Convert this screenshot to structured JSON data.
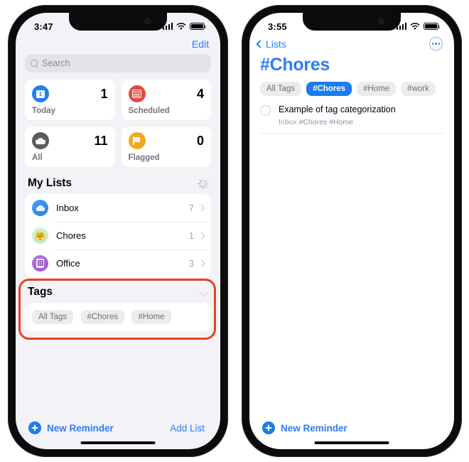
{
  "left_phone": {
    "status": {
      "time": "3:47",
      "signal_icon": "cellular-bars-icon",
      "wifi_icon": "wifi-icon",
      "battery_icon": "battery-icon"
    },
    "edit_button": "Edit",
    "search": {
      "placeholder": "Search",
      "icon": "search-icon"
    },
    "smart_lists": [
      {
        "label": "Today",
        "count": "1",
        "icon": "calendar-today-icon",
        "color": "#1e7ff0"
      },
      {
        "label": "Scheduled",
        "count": "4",
        "icon": "calendar-scheduled-icon",
        "color": "#e8453c"
      },
      {
        "label": "All",
        "count": "11",
        "icon": "tray-all-icon",
        "color": "#5a5a60"
      },
      {
        "label": "Flagged",
        "count": "0",
        "icon": "flag-icon",
        "color": "#f5a623"
      }
    ],
    "my_lists": {
      "title": "My Lists",
      "action_icon": "loading-spinner-icon",
      "items": [
        {
          "name": "Inbox",
          "count": "7",
          "icon": "inbox-icon",
          "color": "#2a7fe0"
        },
        {
          "name": "Chores",
          "count": "1",
          "icon": "chores-emoji-icon",
          "emoji": "🤗",
          "color": "#bfe9c6"
        },
        {
          "name": "Office",
          "count": "3",
          "icon": "building-icon",
          "color": "#9a55cf"
        }
      ]
    },
    "tags": {
      "title": "Tags",
      "collapse_icon": "chevron-down-icon",
      "pills": [
        "All Tags",
        "#Chores",
        "#Home"
      ],
      "highlight_color": "#e8421f"
    },
    "toolbar": {
      "new_reminder": "New Reminder",
      "add_list": "Add List",
      "plus_icon": "plus-circle-icon"
    }
  },
  "right_phone": {
    "status": {
      "time": "3:55",
      "signal_icon": "cellular-bars-icon",
      "wifi_icon": "wifi-icon",
      "battery_icon": "battery-icon"
    },
    "nav": {
      "back_label": "Lists",
      "back_icon": "chevron-left-icon",
      "more_icon": "more-circle-icon"
    },
    "title": "#Chores",
    "tag_filters": [
      {
        "label": "All Tags",
        "active": false
      },
      {
        "label": "#Chores",
        "active": true
      },
      {
        "label": "#Home",
        "active": false
      },
      {
        "label": "#work",
        "active": false
      }
    ],
    "reminders": [
      {
        "title": "Example of tag categorization",
        "list": "Inbox",
        "tags": "#Chores #Home",
        "checkbox_icon": "radio-circle-icon"
      }
    ],
    "toolbar": {
      "new_reminder": "New Reminder",
      "plus_icon": "plus-circle-icon"
    }
  }
}
